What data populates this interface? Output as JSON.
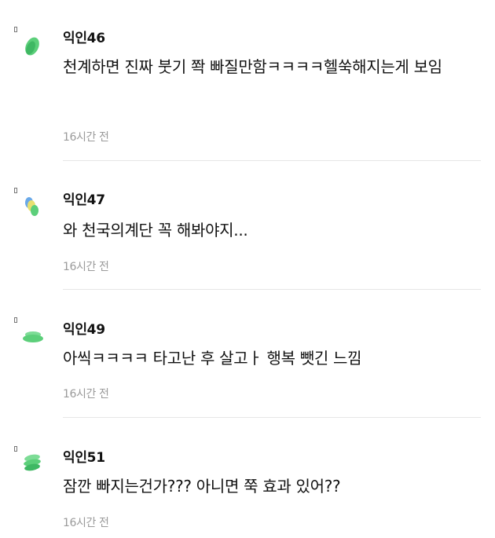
{
  "comments": [
    {
      "nickname": "익인46",
      "text": "천계하면 진짜 붓기 쫙 빠질만함ㅋㅋㅋㅋ헬쑥해지는게 보임",
      "time": "16시간 전",
      "avatar_icon": "green-leaf-icon"
    },
    {
      "nickname": "익인47",
      "text": "와 천국의계단 꼭 해봐야지...",
      "time": "16시간 전",
      "avatar_icon": "blue-yellow-green-dots-icon"
    },
    {
      "nickname": "익인49",
      "text": "아씩ㅋㅋㅋㅋ 타고난 후 살고ㅏ 행복 뺏긴 느낌",
      "time": "16시간 전",
      "avatar_icon": "green-disc-icon"
    },
    {
      "nickname": "익인51",
      "text": "잠깐 빠지는건가??? 아니면 쭉 효과 있어??",
      "time": "16시간 전",
      "avatar_icon": "green-stack-icon"
    }
  ],
  "colors": {
    "avatar_green": "#5ccf7a",
    "avatar_blue": "#6aa9e9",
    "avatar_yellow": "#e8e070",
    "time_gray": "#9a9a9a",
    "divider": "#e6e6e6"
  }
}
